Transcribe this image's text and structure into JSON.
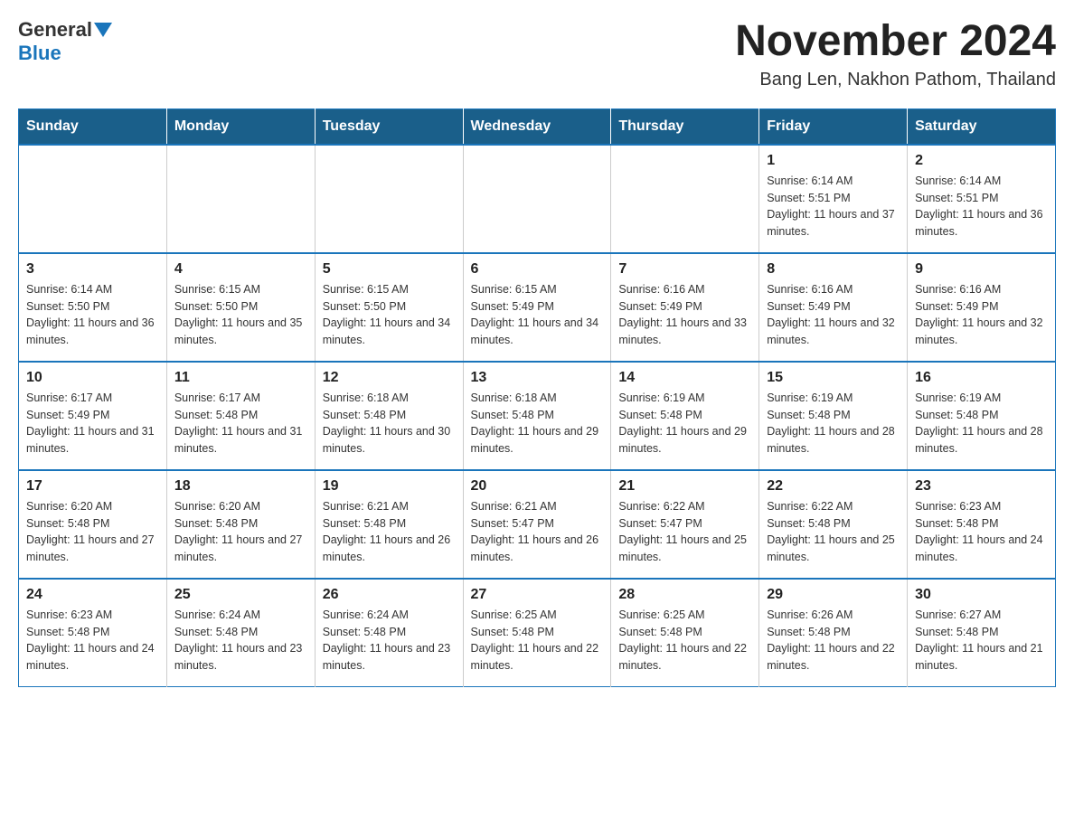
{
  "logo": {
    "general": "General",
    "blue": "Blue"
  },
  "title": "November 2024",
  "subtitle": "Bang Len, Nakhon Pathom, Thailand",
  "days_of_week": [
    "Sunday",
    "Monday",
    "Tuesday",
    "Wednesday",
    "Thursday",
    "Friday",
    "Saturday"
  ],
  "weeks": [
    [
      {
        "day": "",
        "info": ""
      },
      {
        "day": "",
        "info": ""
      },
      {
        "day": "",
        "info": ""
      },
      {
        "day": "",
        "info": ""
      },
      {
        "day": "",
        "info": ""
      },
      {
        "day": "1",
        "info": "Sunrise: 6:14 AM\nSunset: 5:51 PM\nDaylight: 11 hours and 37 minutes."
      },
      {
        "day": "2",
        "info": "Sunrise: 6:14 AM\nSunset: 5:51 PM\nDaylight: 11 hours and 36 minutes."
      }
    ],
    [
      {
        "day": "3",
        "info": "Sunrise: 6:14 AM\nSunset: 5:50 PM\nDaylight: 11 hours and 36 minutes."
      },
      {
        "day": "4",
        "info": "Sunrise: 6:15 AM\nSunset: 5:50 PM\nDaylight: 11 hours and 35 minutes."
      },
      {
        "day": "5",
        "info": "Sunrise: 6:15 AM\nSunset: 5:50 PM\nDaylight: 11 hours and 34 minutes."
      },
      {
        "day": "6",
        "info": "Sunrise: 6:15 AM\nSunset: 5:49 PM\nDaylight: 11 hours and 34 minutes."
      },
      {
        "day": "7",
        "info": "Sunrise: 6:16 AM\nSunset: 5:49 PM\nDaylight: 11 hours and 33 minutes."
      },
      {
        "day": "8",
        "info": "Sunrise: 6:16 AM\nSunset: 5:49 PM\nDaylight: 11 hours and 32 minutes."
      },
      {
        "day": "9",
        "info": "Sunrise: 6:16 AM\nSunset: 5:49 PM\nDaylight: 11 hours and 32 minutes."
      }
    ],
    [
      {
        "day": "10",
        "info": "Sunrise: 6:17 AM\nSunset: 5:49 PM\nDaylight: 11 hours and 31 minutes."
      },
      {
        "day": "11",
        "info": "Sunrise: 6:17 AM\nSunset: 5:48 PM\nDaylight: 11 hours and 31 minutes."
      },
      {
        "day": "12",
        "info": "Sunrise: 6:18 AM\nSunset: 5:48 PM\nDaylight: 11 hours and 30 minutes."
      },
      {
        "day": "13",
        "info": "Sunrise: 6:18 AM\nSunset: 5:48 PM\nDaylight: 11 hours and 29 minutes."
      },
      {
        "day": "14",
        "info": "Sunrise: 6:19 AM\nSunset: 5:48 PM\nDaylight: 11 hours and 29 minutes."
      },
      {
        "day": "15",
        "info": "Sunrise: 6:19 AM\nSunset: 5:48 PM\nDaylight: 11 hours and 28 minutes."
      },
      {
        "day": "16",
        "info": "Sunrise: 6:19 AM\nSunset: 5:48 PM\nDaylight: 11 hours and 28 minutes."
      }
    ],
    [
      {
        "day": "17",
        "info": "Sunrise: 6:20 AM\nSunset: 5:48 PM\nDaylight: 11 hours and 27 minutes."
      },
      {
        "day": "18",
        "info": "Sunrise: 6:20 AM\nSunset: 5:48 PM\nDaylight: 11 hours and 27 minutes."
      },
      {
        "day": "19",
        "info": "Sunrise: 6:21 AM\nSunset: 5:48 PM\nDaylight: 11 hours and 26 minutes."
      },
      {
        "day": "20",
        "info": "Sunrise: 6:21 AM\nSunset: 5:47 PM\nDaylight: 11 hours and 26 minutes."
      },
      {
        "day": "21",
        "info": "Sunrise: 6:22 AM\nSunset: 5:47 PM\nDaylight: 11 hours and 25 minutes."
      },
      {
        "day": "22",
        "info": "Sunrise: 6:22 AM\nSunset: 5:48 PM\nDaylight: 11 hours and 25 minutes."
      },
      {
        "day": "23",
        "info": "Sunrise: 6:23 AM\nSunset: 5:48 PM\nDaylight: 11 hours and 24 minutes."
      }
    ],
    [
      {
        "day": "24",
        "info": "Sunrise: 6:23 AM\nSunset: 5:48 PM\nDaylight: 11 hours and 24 minutes."
      },
      {
        "day": "25",
        "info": "Sunrise: 6:24 AM\nSunset: 5:48 PM\nDaylight: 11 hours and 23 minutes."
      },
      {
        "day": "26",
        "info": "Sunrise: 6:24 AM\nSunset: 5:48 PM\nDaylight: 11 hours and 23 minutes."
      },
      {
        "day": "27",
        "info": "Sunrise: 6:25 AM\nSunset: 5:48 PM\nDaylight: 11 hours and 22 minutes."
      },
      {
        "day": "28",
        "info": "Sunrise: 6:25 AM\nSunset: 5:48 PM\nDaylight: 11 hours and 22 minutes."
      },
      {
        "day": "29",
        "info": "Sunrise: 6:26 AM\nSunset: 5:48 PM\nDaylight: 11 hours and 22 minutes."
      },
      {
        "day": "30",
        "info": "Sunrise: 6:27 AM\nSunset: 5:48 PM\nDaylight: 11 hours and 21 minutes."
      }
    ]
  ]
}
